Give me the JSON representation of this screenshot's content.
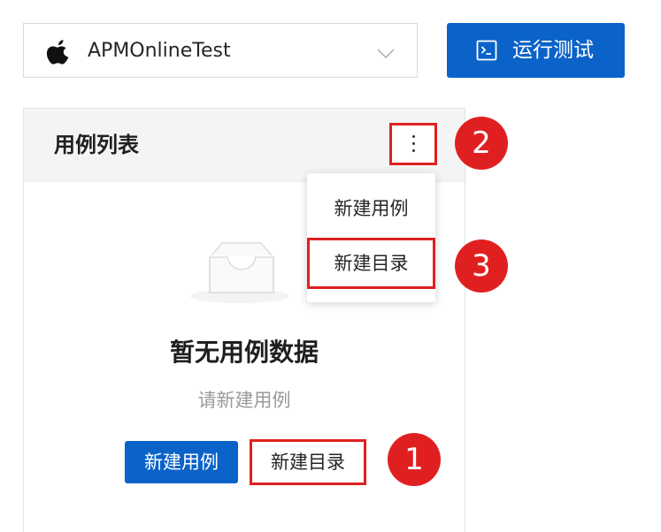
{
  "app_select": {
    "value": "APMOnlineTest",
    "icon": "apple-icon",
    "chevron_icon": "chevron-down-icon"
  },
  "run_button": {
    "label": "运行测试",
    "icon": "terminal-icon"
  },
  "card": {
    "title": "用例列表",
    "more_icon": "more-vertical-icon",
    "empty_state": {
      "icon": "empty-inbox-icon",
      "title": "暂无用例数据",
      "subtitle": "请新建用例"
    },
    "actions": {
      "new_case": "新建用例",
      "new_directory": "新建目录"
    }
  },
  "dropdown": {
    "items": [
      {
        "label": "新建用例"
      },
      {
        "label": "新建目录"
      }
    ]
  },
  "markers": [
    "1",
    "2",
    "3"
  ],
  "colors": {
    "primary": "#0b63c9",
    "highlight": "#e02020",
    "header_bg": "#f4f4f4",
    "muted_text": "#9a9a9a"
  }
}
